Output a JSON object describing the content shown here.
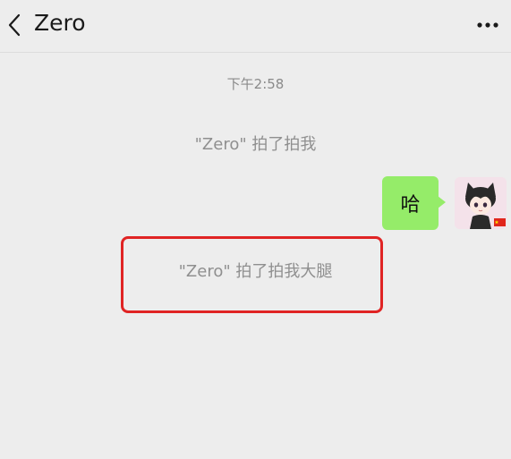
{
  "header": {
    "title": "Zero",
    "back_icon": "chevron-left-icon",
    "more_icon": "more-dots-icon"
  },
  "chat": {
    "timestamp": "下午2:58",
    "system_messages": [
      "\"Zero\" 拍了拍我",
      "\"Zero\" 拍了拍我大腿"
    ],
    "sent_message": {
      "text": "哈",
      "bubble_color": "#95ec69"
    }
  },
  "colors": {
    "background": "#ededed",
    "highlight": "#e02424"
  }
}
